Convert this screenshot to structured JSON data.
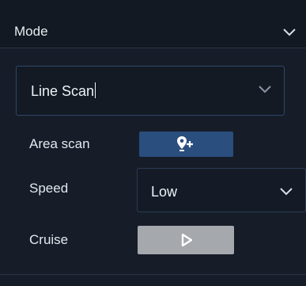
{
  "header": {
    "title": "Mode",
    "chevron": "chevron-down-icon"
  },
  "mode_select": {
    "value": "Line Scan",
    "chevron": "chevron-down-icon"
  },
  "area_scan": {
    "label": "Area scan",
    "button_icon": "map-pin-add-icon"
  },
  "speed": {
    "label": "Speed",
    "value": "Low",
    "chevron": "chevron-down-icon"
  },
  "cruise": {
    "label": "Cruise",
    "button_icon": "play-icon"
  },
  "colors": {
    "background": "#161d28",
    "header_bg": "#121922",
    "area_button": "#2a4e7d",
    "cruise_button": "#a5a9ae",
    "text": "#eef2f7",
    "select_border": "#2f4668"
  }
}
